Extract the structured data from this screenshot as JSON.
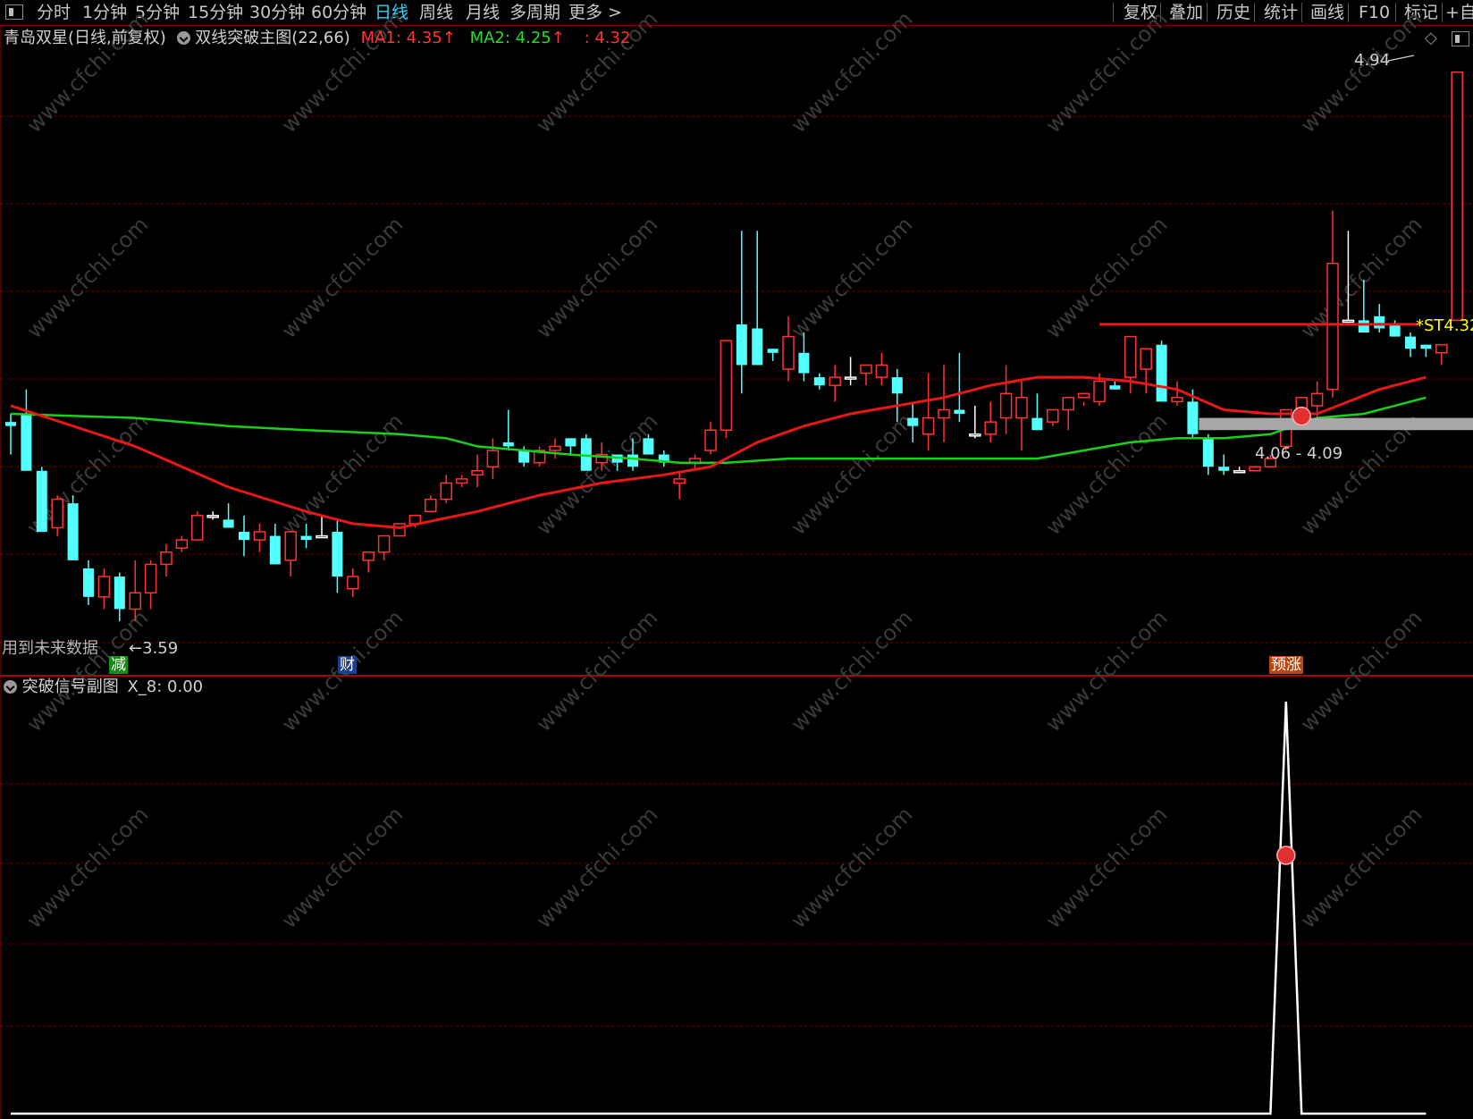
{
  "topbar": {
    "tabs": [
      "分时",
      "1分钟",
      "5分钟",
      "15分钟",
      "30分钟",
      "60分钟",
      "日线",
      "周线",
      "月线",
      "多周期",
      "更多 >"
    ],
    "active_tab": "日线",
    "tools": [
      "复权",
      "叠加",
      "历史",
      "统计",
      "画线",
      "F10",
      "标记",
      "+自"
    ]
  },
  "main_header": {
    "stock": "青岛双星(日线,前复权)",
    "indicator": "双线突破主图(22,66)",
    "ma1_label": "MA1: 4.35",
    "ma2_label": "MA2: 4.25",
    "extra_label": ": 4.32",
    "arrow_up": "↑"
  },
  "sub_header": {
    "indicator": "突破信号副图",
    "value_label": "X_8: 0.00"
  },
  "annotations": {
    "future_data": "用到未来数据",
    "low_price": "←3.59",
    "high_price": "4.94",
    "range_box": "4.06 - 4.09",
    "st_price": "*ST4.32",
    "tag_jian": "减",
    "tag_cai": "财",
    "tag_yuzhang": "预涨"
  },
  "watermark": "www.cfchi.com",
  "colors": {
    "up": "#ff3232",
    "down": "#54ffff",
    "ma1": "#e81818",
    "ma2": "#19d119",
    "grid": "#6e0000",
    "signal_line": "#ffffff",
    "range_box": "#a8a8a8",
    "st_label": "#ffff00"
  },
  "chart_data": [
    {
      "type": "candlestick",
      "title": "双线突破主图(22,66)",
      "series_names": [
        "MA1",
        "MA2"
      ],
      "candles": [
        [
          4.08,
          4.1,
          4.0,
          4.07
        ],
        [
          4.1,
          4.16,
          3.96,
          3.96
        ],
        [
          3.96,
          3.97,
          3.81,
          3.81
        ],
        [
          3.82,
          3.9,
          3.8,
          3.89
        ],
        [
          3.88,
          3.9,
          3.74,
          3.74
        ],
        [
          3.72,
          3.74,
          3.63,
          3.65
        ],
        [
          3.65,
          3.72,
          3.62,
          3.7
        ],
        [
          3.7,
          3.71,
          3.59,
          3.62
        ],
        [
          3.62,
          3.74,
          3.59,
          3.66
        ],
        [
          3.66,
          3.74,
          3.62,
          3.73
        ],
        [
          3.73,
          3.78,
          3.7,
          3.76
        ],
        [
          3.77,
          3.8,
          3.76,
          3.79
        ],
        [
          3.79,
          3.86,
          3.79,
          3.85
        ],
        [
          3.85,
          3.86,
          3.84,
          3.85
        ],
        [
          3.84,
          3.88,
          3.82,
          3.82
        ],
        [
          3.81,
          3.85,
          3.75,
          3.79
        ],
        [
          3.79,
          3.83,
          3.76,
          3.81
        ],
        [
          3.8,
          3.83,
          3.73,
          3.73
        ],
        [
          3.74,
          3.8,
          3.7,
          3.81
        ],
        [
          3.8,
          3.83,
          3.77,
          3.79
        ],
        [
          3.8,
          3.85,
          3.8,
          3.8
        ],
        [
          3.81,
          3.84,
          3.66,
          3.7
        ],
        [
          3.67,
          3.72,
          3.65,
          3.7
        ],
        [
          3.74,
          3.76,
          3.71,
          3.76
        ],
        [
          3.76,
          3.8,
          3.74,
          3.8
        ],
        [
          3.8,
          3.83,
          3.8,
          3.83
        ],
        [
          3.83,
          3.85,
          3.82,
          3.85
        ],
        [
          3.86,
          3.9,
          3.86,
          3.89
        ],
        [
          3.89,
          3.95,
          3.88,
          3.93
        ],
        [
          3.93,
          3.95,
          3.92,
          3.94
        ],
        [
          3.95,
          4.0,
          3.92,
          3.96
        ],
        [
          3.97,
          4.04,
          3.94,
          4.01
        ],
        [
          4.03,
          4.11,
          4.01,
          4.02
        ],
        [
          4.01,
          4.02,
          3.97,
          3.98
        ],
        [
          3.98,
          4.02,
          3.97,
          4.01
        ],
        [
          4.01,
          4.04,
          3.99,
          4.02
        ],
        [
          4.04,
          4.04,
          4.0,
          4.02
        ],
        [
          4.04,
          4.05,
          3.99,
          3.96
        ],
        [
          3.98,
          4.03,
          3.96,
          4.0
        ],
        [
          4.0,
          4.0,
          3.96,
          3.98
        ],
        [
          4.0,
          4.04,
          3.96,
          3.97
        ],
        [
          4.04,
          4.05,
          4.01,
          4.0
        ],
        [
          4.0,
          4.01,
          3.97,
          3.98
        ],
        [
          3.93,
          3.96,
          3.89,
          3.94
        ],
        [
          3.98,
          4.0,
          3.96,
          3.99
        ],
        [
          4.01,
          4.08,
          4.0,
          4.06
        ],
        [
          4.06,
          4.28,
          4.04,
          4.28
        ],
        [
          4.32,
          4.55,
          4.15,
          4.22
        ],
        [
          4.31,
          4.55,
          4.22,
          4.22
        ],
        [
          4.26,
          4.26,
          4.23,
          4.25
        ],
        [
          4.21,
          4.34,
          4.18,
          4.29
        ],
        [
          4.25,
          4.3,
          4.18,
          4.2
        ],
        [
          4.19,
          4.2,
          4.16,
          4.17
        ],
        [
          4.17,
          4.22,
          4.13,
          4.19
        ],
        [
          4.19,
          4.24,
          4.17,
          4.19
        ],
        [
          4.2,
          4.21,
          4.17,
          4.22
        ],
        [
          4.19,
          4.25,
          4.17,
          4.22
        ],
        [
          4.19,
          4.21,
          4.08,
          4.15
        ],
        [
          4.09,
          4.13,
          4.03,
          4.07
        ],
        [
          4.05,
          4.2,
          4.01,
          4.09
        ],
        [
          4.09,
          4.22,
          4.03,
          4.11
        ],
        [
          4.11,
          4.25,
          4.08,
          4.1
        ],
        [
          4.05,
          4.12,
          4.04,
          4.05
        ],
        [
          4.05,
          4.13,
          4.03,
          4.08
        ],
        [
          4.09,
          4.22,
          4.05,
          4.15
        ],
        [
          4.09,
          4.18,
          4.01,
          4.14
        ],
        [
          4.09,
          4.15,
          4.06,
          4.06
        ],
        [
          4.08,
          4.11,
          4.07,
          4.11
        ],
        [
          4.11,
          4.14,
          4.06,
          4.14
        ],
        [
          4.14,
          4.13,
          4.12,
          4.15
        ],
        [
          4.13,
          4.2,
          4.12,
          4.18
        ],
        [
          4.17,
          4.18,
          4.16,
          4.16
        ],
        [
          4.19,
          4.28,
          4.15,
          4.29
        ],
        [
          4.21,
          4.26,
          4.15,
          4.26
        ],
        [
          4.27,
          4.28,
          4.15,
          4.13
        ],
        [
          4.13,
          4.18,
          4.12,
          4.14
        ],
        [
          4.13,
          4.16,
          4.04,
          4.05
        ],
        [
          4.04,
          4.05,
          3.95,
          3.97
        ],
        [
          3.97,
          4.0,
          3.95,
          3.96
        ],
        [
          3.96,
          3.97,
          3.96,
          3.96
        ],
        [
          3.96,
          3.97,
          3.96,
          3.97
        ],
        [
          3.97,
          4.0,
          3.97,
          3.99
        ],
        [
          4.02,
          4.09,
          4.01,
          4.11
        ],
        [
          4.11,
          4.14,
          4.1,
          4.14
        ],
        [
          4.12,
          4.18,
          4.09,
          4.15
        ],
        [
          4.16,
          4.6,
          4.14,
          4.47
        ],
        [
          4.33,
          4.55,
          4.32,
          4.33
        ],
        [
          4.33,
          4.43,
          4.3,
          4.3
        ],
        [
          4.34,
          4.37,
          4.3,
          4.31
        ],
        [
          4.32,
          4.33,
          4.29,
          4.29
        ],
        [
          4.29,
          4.3,
          4.24,
          4.26
        ],
        [
          4.27,
          4.27,
          4.24,
          4.26
        ],
        [
          4.25,
          4.27,
          4.22,
          4.27
        ],
        [
          4.33,
          4.94,
          4.33,
          4.94
        ]
      ],
      "ma1_points": [
        [
          0,
          4.12
        ],
        [
          8,
          4.02
        ],
        [
          14,
          3.92
        ],
        [
          19,
          3.86
        ],
        [
          22,
          3.83
        ],
        [
          25,
          3.82
        ],
        [
          30,
          3.86
        ],
        [
          34,
          3.9
        ],
        [
          38,
          3.93
        ],
        [
          42,
          3.95
        ],
        [
          45,
          3.97
        ],
        [
          48,
          4.03
        ],
        [
          51,
          4.07
        ],
        [
          54,
          4.1
        ],
        [
          57,
          4.12
        ],
        [
          60,
          4.14
        ],
        [
          63,
          4.17
        ],
        [
          66,
          4.19
        ],
        [
          69,
          4.19
        ],
        [
          72,
          4.18
        ],
        [
          75,
          4.16
        ],
        [
          78,
          4.11
        ],
        [
          81,
          4.1
        ],
        [
          84,
          4.1
        ],
        [
          86,
          4.13
        ],
        [
          88,
          4.16
        ],
        [
          91,
          4.19
        ]
      ],
      "ma2_points": [
        [
          0,
          4.1
        ],
        [
          8,
          4.09
        ],
        [
          14,
          4.07
        ],
        [
          19,
          4.06
        ],
        [
          25,
          4.05
        ],
        [
          28,
          4.04
        ],
        [
          30,
          4.02
        ],
        [
          33,
          4.01
        ],
        [
          36,
          4.0
        ],
        [
          40,
          3.99
        ],
        [
          43,
          3.98
        ],
        [
          46,
          3.98
        ],
        [
          50,
          3.99
        ],
        [
          55,
          3.99
        ],
        [
          60,
          3.99
        ],
        [
          66,
          3.99
        ],
        [
          69,
          4.01
        ],
        [
          72,
          4.03
        ],
        [
          75,
          4.04
        ],
        [
          78,
          4.04
        ],
        [
          81,
          4.05
        ],
        [
          84,
          4.09
        ],
        [
          87,
          4.1
        ],
        [
          89,
          4.12
        ],
        [
          91,
          4.14
        ]
      ],
      "ylim": [
        3.52,
        4.99
      ]
    },
    {
      "type": "line",
      "title": "突破信号副图",
      "series_names": [
        "X_8"
      ],
      "x": [
        0,
        81,
        82,
        83,
        91
      ],
      "values": [
        0,
        0,
        1,
        0,
        0
      ],
      "ylim": [
        0,
        1
      ]
    }
  ]
}
